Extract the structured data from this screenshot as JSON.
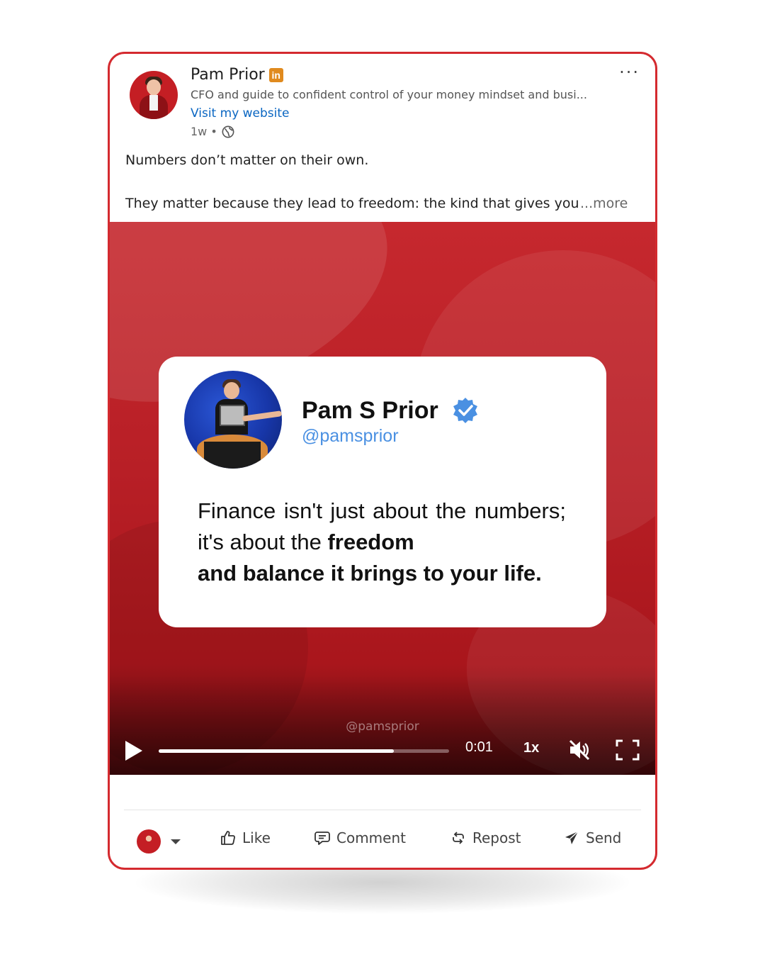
{
  "post": {
    "author_name": "Pam Prior",
    "linkedin_badge": "in",
    "headline": "CFO and guide to confident control of your money mindset and busi...",
    "visit_link": "Visit my website",
    "time_ago": "1w •",
    "text_line1": "Numbers don’t matter on their own.",
    "text_line2": "They matter because they lead to freedom: the kind that gives you",
    "see_more": "...more",
    "menu_icon": "more-horizontal-icon"
  },
  "quote_card": {
    "name": "Pam S Prior",
    "handle": "@pamsprior",
    "text_start": "Finance isn't just about the numbers; it's about the ",
    "text_bold": "freedom",
    "text_last": "and balance it brings to your life."
  },
  "video": {
    "watermark": "@pamsprior",
    "time": "0:01",
    "speed": "1x",
    "progress_fraction": 0.81,
    "muted": true
  },
  "actions": {
    "like": "Like",
    "comment": "Comment",
    "repost": "Repost",
    "send": "Send"
  },
  "colors": {
    "accent_red": "#d42a2f",
    "link_blue": "#0a66c2",
    "verified_blue": "#4a90e2",
    "linkedin_badge": "#e08a1e"
  }
}
